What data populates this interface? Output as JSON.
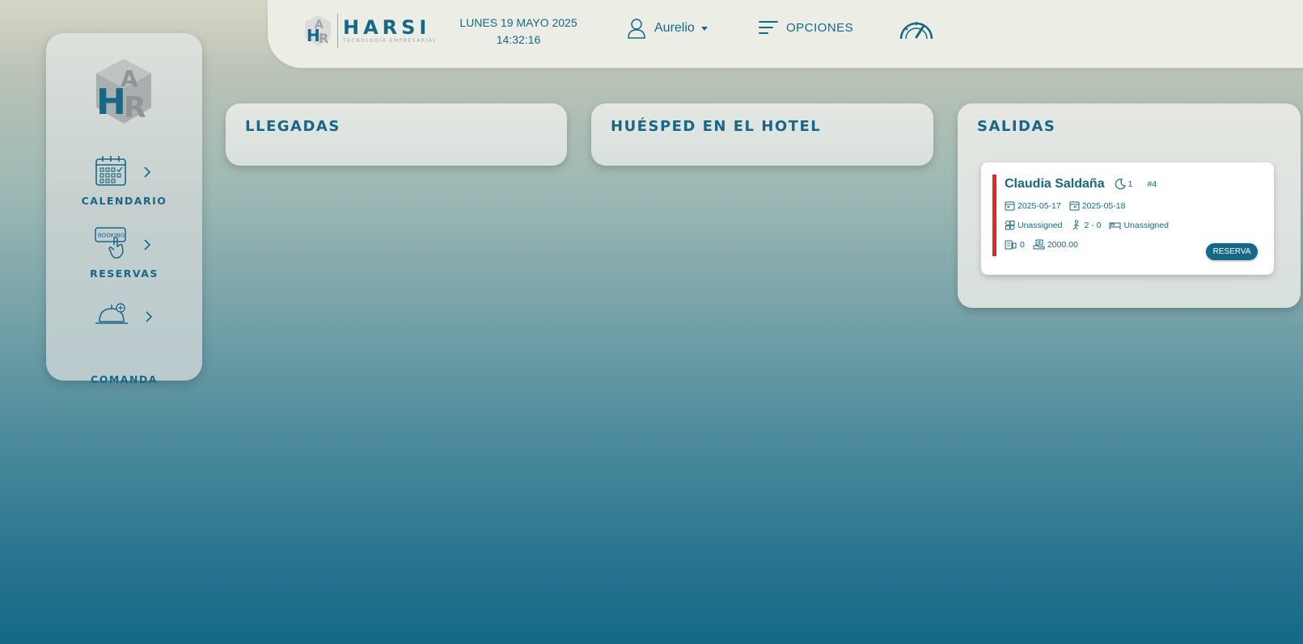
{
  "brand": {
    "name": "HARSI",
    "tagline": "TECNOLOGÍA EMPRESARIAL",
    "logo_letters": "HAR"
  },
  "datetime": {
    "date": "LUNES 19 MAYO 2025",
    "time": "14:32:16"
  },
  "user": {
    "name": "Aurelio",
    "icon": "user-icon"
  },
  "options": {
    "label": "OPCIONES",
    "icon": "menu-lines-icon"
  },
  "gauge": {
    "icon": "speedometer-icon"
  },
  "sidebar": {
    "items": [
      {
        "label": "CALENDARIO",
        "icon": "calendar-icon"
      },
      {
        "label": "RESERVAS",
        "icon": "booking-hand-icon",
        "icon_text": "BOOKING"
      },
      {
        "label": "COMANDA",
        "icon": "service-bell-icon"
      }
    ]
  },
  "panels": {
    "arrivals": {
      "title": "LLEGADAS"
    },
    "in_hotel": {
      "title": "HUÉSPED EN EL HOTEL"
    },
    "departures": {
      "title": "SALIDAS",
      "cards": [
        {
          "guest": "Claudia Saldaña",
          "nights": "1",
          "reservation_no": "#4",
          "check_in": "2025-05-17",
          "check_out": "2025-05-18",
          "room_type": "Unassigned",
          "guests": "2 - 0",
          "room": "Unassigned",
          "extras": "0",
          "amount": "2000.00",
          "button": "RESERVA",
          "status_color": "#e8281f"
        }
      ]
    }
  },
  "colors": {
    "primary": "#146888",
    "accent_red": "#e8281f",
    "gray_logo": "#9aa4a8"
  }
}
